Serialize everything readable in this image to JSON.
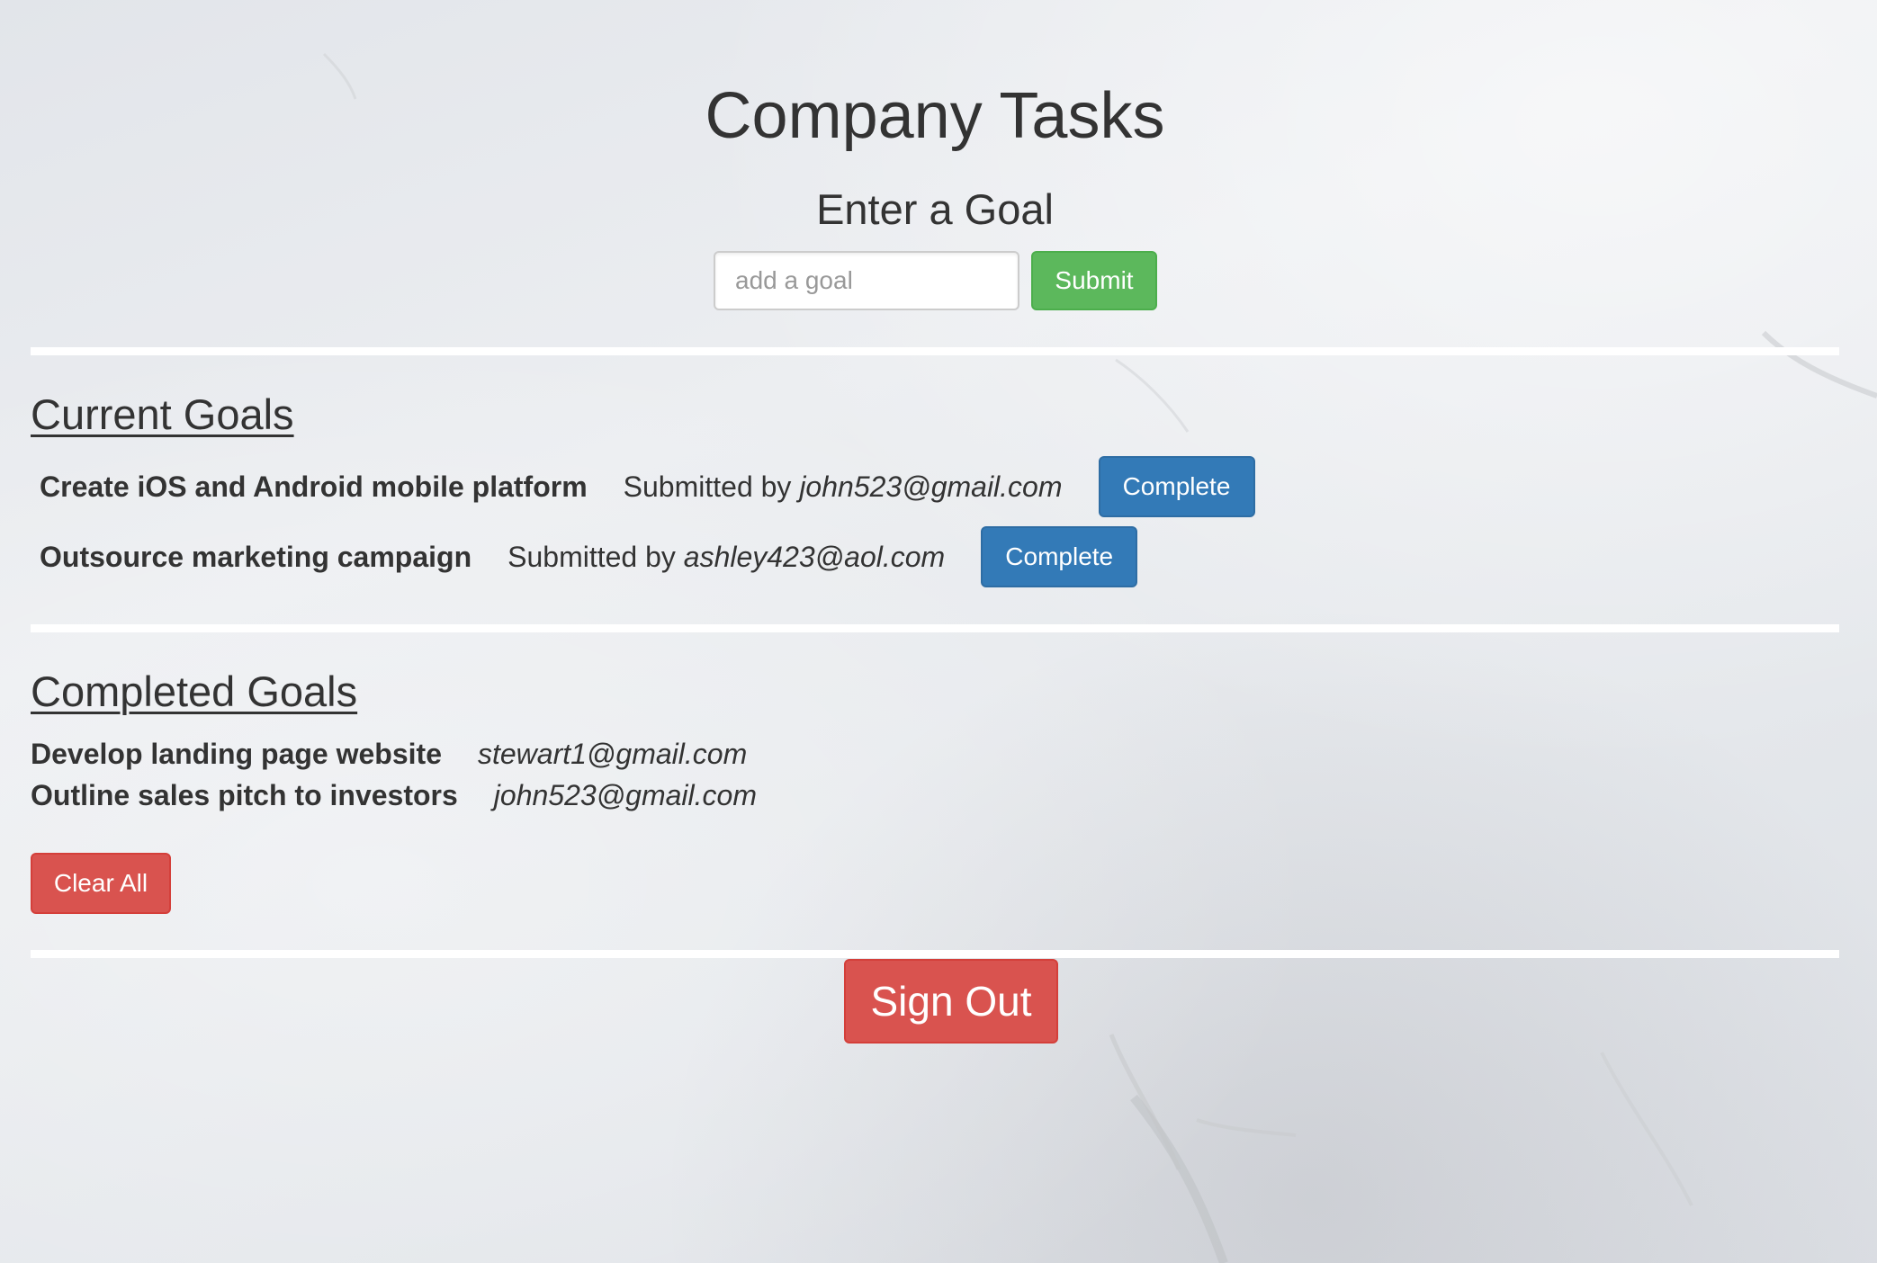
{
  "page": {
    "title": "Company Tasks",
    "subtitle": "Enter a Goal"
  },
  "goal_form": {
    "placeholder": "add a goal",
    "value": "",
    "submit_label": "Submit"
  },
  "current_goals": {
    "heading": "Current Goals",
    "items": [
      {
        "goal": "Create iOS and Android mobile platform",
        "submitted_prefix": "Submitted by",
        "email": "john523@gmail.com",
        "button_label": "Complete"
      },
      {
        "goal": "Outsource marketing campaign",
        "submitted_prefix": "Submitted by",
        "email": "ashley423@aol.com",
        "button_label": "Complete"
      }
    ]
  },
  "completed_goals": {
    "heading": "Completed Goals",
    "items": [
      {
        "goal": "Develop landing page website",
        "email": "stewart1@gmail.com"
      },
      {
        "goal": "Outline sales pitch to investors",
        "email": "john523@gmail.com"
      }
    ],
    "clear_label": "Clear All"
  },
  "footer": {
    "sign_out_label": "Sign Out"
  },
  "colors": {
    "success": "#5cb85c",
    "primary": "#337ab7",
    "danger": "#d9534f",
    "text": "#333333",
    "divider": "#ffffff"
  }
}
